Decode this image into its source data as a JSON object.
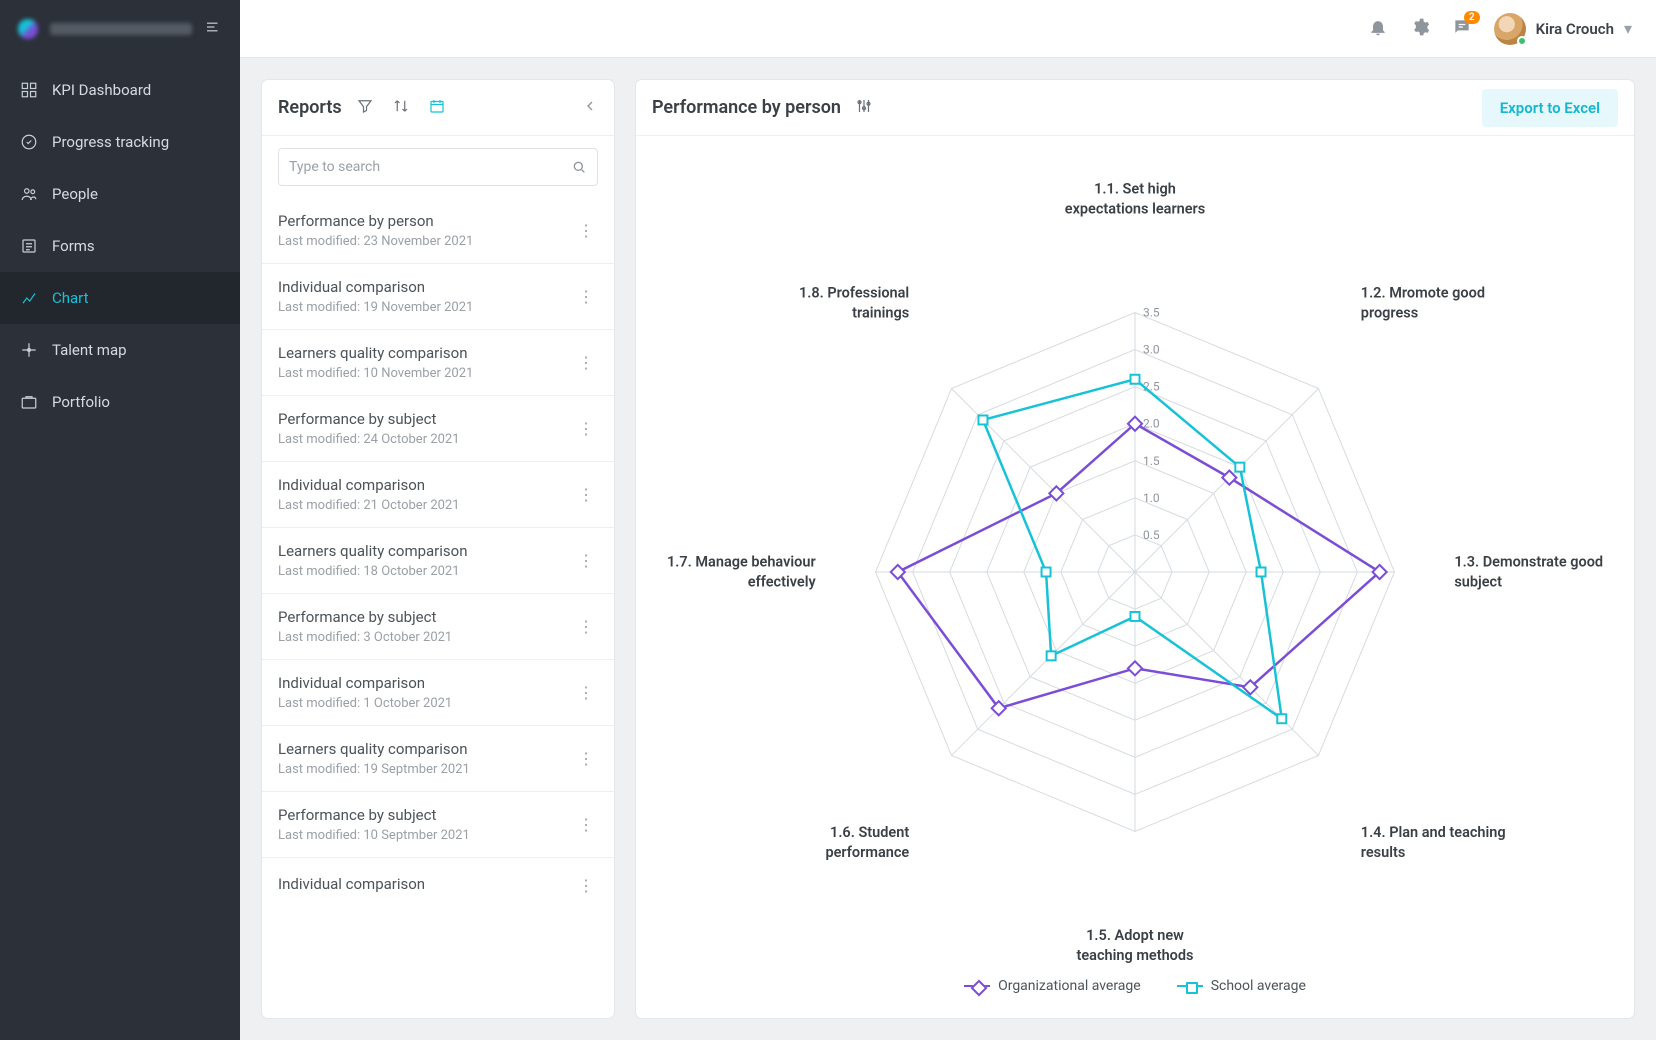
{
  "brand_menu_icon": "menu",
  "sidebar": {
    "items": [
      {
        "label": "KPI Dashboard",
        "icon": "dashboard"
      },
      {
        "label": "Progress tracking",
        "icon": "progress"
      },
      {
        "label": "People",
        "icon": "people"
      },
      {
        "label": "Forms",
        "icon": "forms"
      },
      {
        "label": "Chart",
        "icon": "chart",
        "active": true
      },
      {
        "label": "Talent map",
        "icon": "talent"
      },
      {
        "label": "Portfolio",
        "icon": "portfolio"
      }
    ]
  },
  "header": {
    "notification_count": "2",
    "user_name": "Kira Crouch"
  },
  "reports_panel": {
    "title": "Reports",
    "search_placeholder": "Type to search",
    "last_modified_prefix": "Last modified: ",
    "items": [
      {
        "title": "Performance by person",
        "modified": "23 November 2021"
      },
      {
        "title": "Individual comparison",
        "modified": "19 November 2021"
      },
      {
        "title": "Learners quality comparison",
        "modified": "10 November 2021"
      },
      {
        "title": "Performance by subject",
        "modified": "24 October 2021"
      },
      {
        "title": "Individual comparison",
        "modified": "21 October 2021"
      },
      {
        "title": "Learners quality comparison",
        "modified": "18 October 2021"
      },
      {
        "title": "Performance by subject",
        "modified": "3 October 2021"
      },
      {
        "title": "Individual comparison",
        "modified": "1 October 2021"
      },
      {
        "title": "Learners quality comparison",
        "modified": "19 Septmber 2021"
      },
      {
        "title": "Performance by subject",
        "modified": "10 Septmber 2021"
      },
      {
        "title": "Individual comparison",
        "modified": ""
      }
    ]
  },
  "chart_panel": {
    "title": "Performance by person",
    "export_label": "Export to Excel",
    "legend": {
      "org": "Organizational average",
      "school": "School average"
    }
  },
  "chart_data": {
    "type": "radar",
    "categories": [
      "1.1. Set high expectations learners",
      "1.2. Mromote good progress",
      "1.3. Demonstrate good subject",
      "1.4. Plan and teaching results",
      "1.5. Adopt new teaching methods",
      "1.6. Student performance",
      "1.7. Manage behaviour effectively",
      "1.8. Professional trainings"
    ],
    "ticks": [
      0.5,
      1.0,
      1.5,
      2.0,
      2.5,
      3.0,
      3.5
    ],
    "max": 3.5,
    "series": [
      {
        "name": "Organizational average",
        "color": "#7b4dd6",
        "marker": "diamond",
        "values": [
          2.0,
          1.8,
          3.3,
          2.2,
          1.3,
          2.6,
          3.2,
          1.5
        ]
      },
      {
        "name": "School average",
        "color": "#17c2d7",
        "marker": "square",
        "values": [
          2.6,
          2.0,
          1.7,
          2.8,
          0.6,
          1.6,
          1.2,
          2.9
        ]
      }
    ]
  }
}
